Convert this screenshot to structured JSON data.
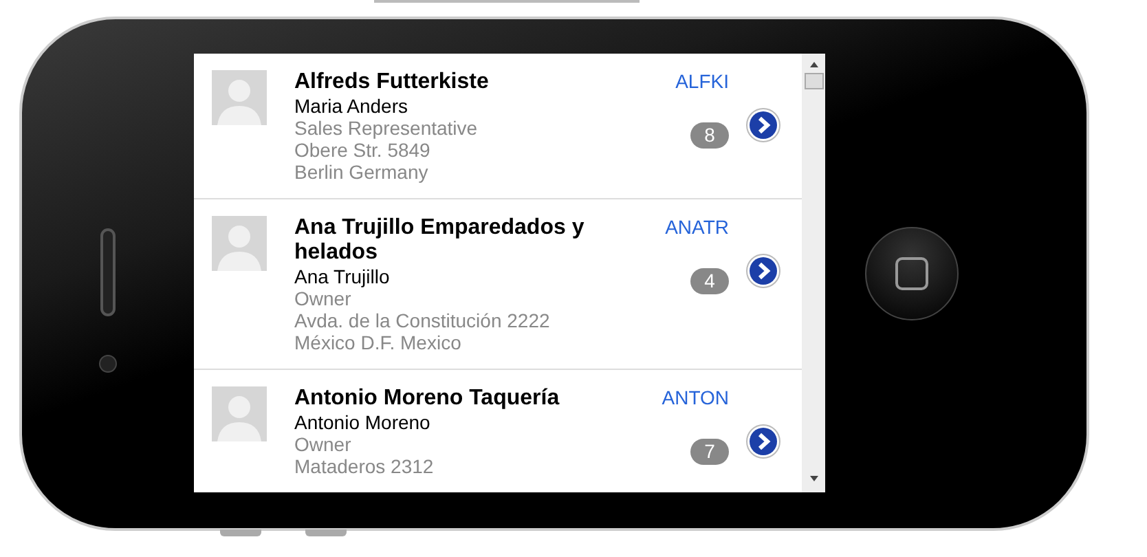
{
  "customers": [
    {
      "company": "Alfreds Futterkiste",
      "contact": "Maria Anders",
      "title": "Sales Representative",
      "address": "Obere Str. 5849",
      "city": "Berlin Germany",
      "code": "ALFKI",
      "count": "8"
    },
    {
      "company": "Ana Trujillo Emparedados y helados",
      "contact": "Ana Trujillo",
      "title": "Owner",
      "address": "Avda. de la Constitución 2222",
      "city": "México D.F. Mexico",
      "code": "ANATR",
      "count": "4"
    },
    {
      "company": "Antonio Moreno Taquería",
      "contact": "Antonio Moreno",
      "title": "Owner",
      "address": "Mataderos 2312",
      "code": "ANTON",
      "count": "7"
    }
  ]
}
